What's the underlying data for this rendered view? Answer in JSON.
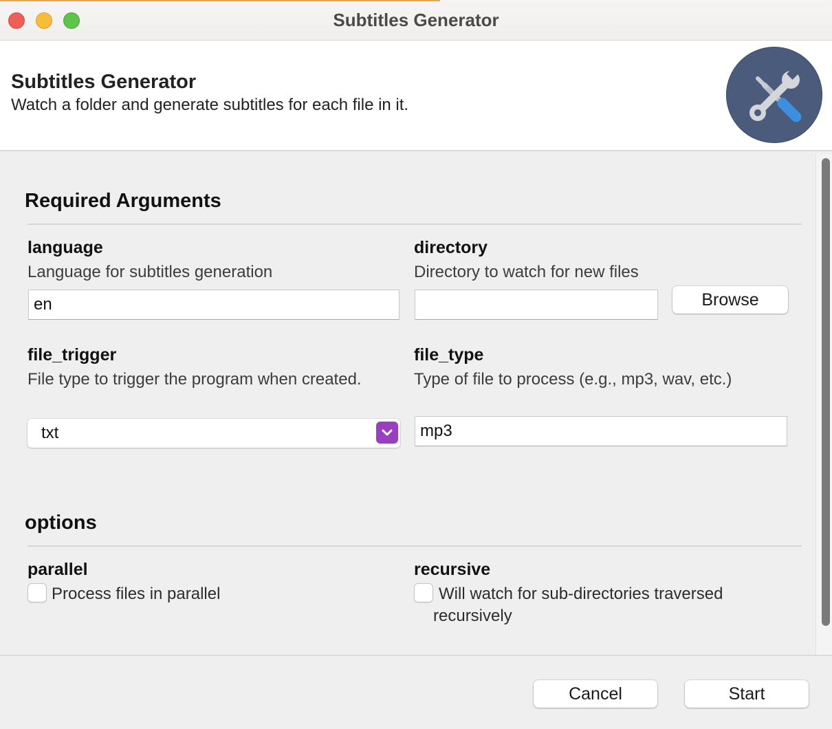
{
  "window": {
    "title": "Subtitles Generator"
  },
  "header": {
    "title": "Subtitles Generator",
    "subtitle": "Watch a folder and generate subtitles for each file in it.",
    "icon": "tools-icon"
  },
  "required_section": {
    "title": "Required Arguments",
    "fields": {
      "language": {
        "label": "language",
        "help": "Language for subtitles generation",
        "value": "en"
      },
      "directory": {
        "label": "directory",
        "help": "Directory to watch for new files",
        "value": "",
        "browse_label": "Browse"
      },
      "file_trigger": {
        "label": "file_trigger",
        "help": "File type to trigger the program when created.",
        "selected": "txt"
      },
      "file_type": {
        "label": "file_type",
        "help": "Type of file to process (e.g., mp3, wav, etc.)",
        "value": "mp3"
      }
    }
  },
  "options_section": {
    "title": "options",
    "fields": {
      "parallel": {
        "label": "parallel",
        "text": "Process files in parallel",
        "checked": false
      },
      "recursive": {
        "label": "recursive",
        "text_line1": "Will watch for sub-directories traversed",
        "text_line2": "recursively",
        "checked": false
      }
    }
  },
  "footer": {
    "cancel_label": "Cancel",
    "start_label": "Start"
  },
  "colors": {
    "header_icon_bg": "#4b5b7c",
    "dropdown_accent": "#9a3fbf",
    "titlebar_accent": "#e8a849"
  }
}
